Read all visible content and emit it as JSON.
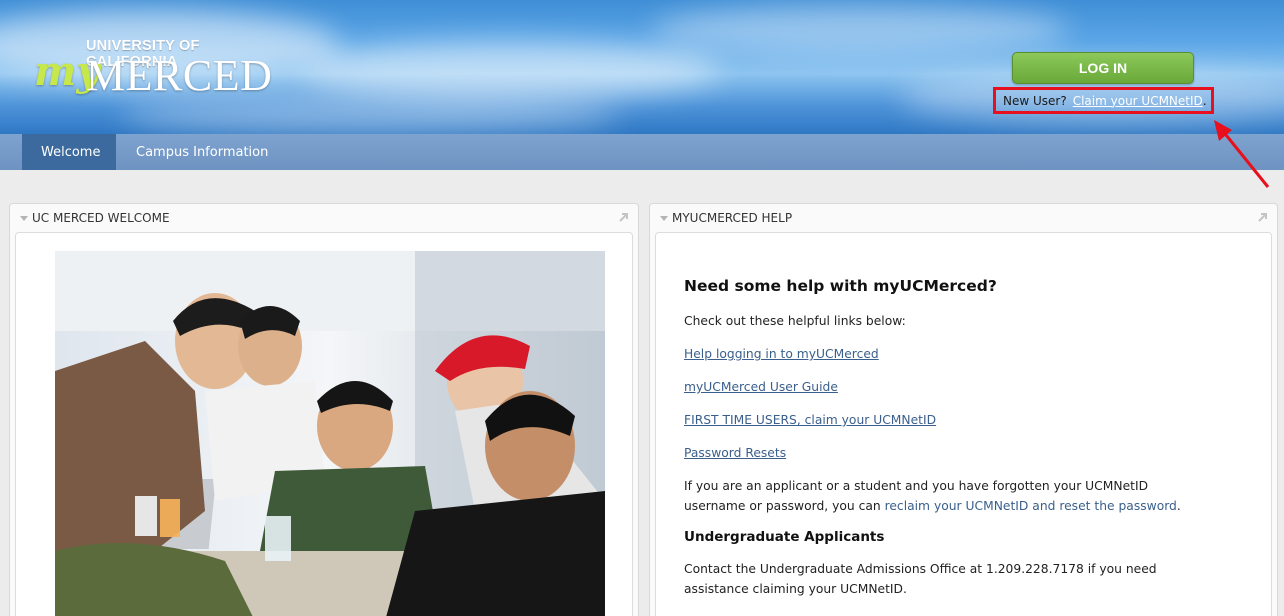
{
  "header": {
    "logo": {
      "top": "UNIVERSITY OF CALIFORNIA",
      "my": "my",
      "merced": "MERCED"
    },
    "login_label": "LOG IN",
    "new_user_label": "New User?",
    "claim_link": "Claim your UCMNetID",
    "claim_suffix": "."
  },
  "nav": {
    "tabs": [
      {
        "label": "Welcome",
        "active": true
      },
      {
        "label": "Campus Information",
        "active": false
      }
    ]
  },
  "portlets": {
    "welcome": {
      "title": "UC MERCED WELCOME"
    },
    "help": {
      "title": "MYUCMERCED HELP",
      "heading": "Need some help with myUCMerced?",
      "intro": "Check out these helpful links below:",
      "links": [
        "Help logging in to myUCMerced",
        "myUCMerced User Guide",
        "FIRST TIME USERS, claim your UCMNetID",
        "Password Resets"
      ],
      "forgot_text_1": "If you are an applicant or a student and you have forgotten your UCMNetID username or password, you can ",
      "forgot_link": "reclaim your UCMNetID and reset the password",
      "forgot_text_2": ".",
      "undergrad_heading": "Undergraduate Applicants",
      "undergrad_text": "Contact the Undergraduate Admissions Office at 1.209.228.7178 if you need assistance claiming your UCMNetID."
    }
  },
  "colors": {
    "nav_active": "#3c6a9e",
    "login_green": "#6aa83a",
    "annotation_red": "#e8101c",
    "link_blue": "#3a5f8c"
  }
}
